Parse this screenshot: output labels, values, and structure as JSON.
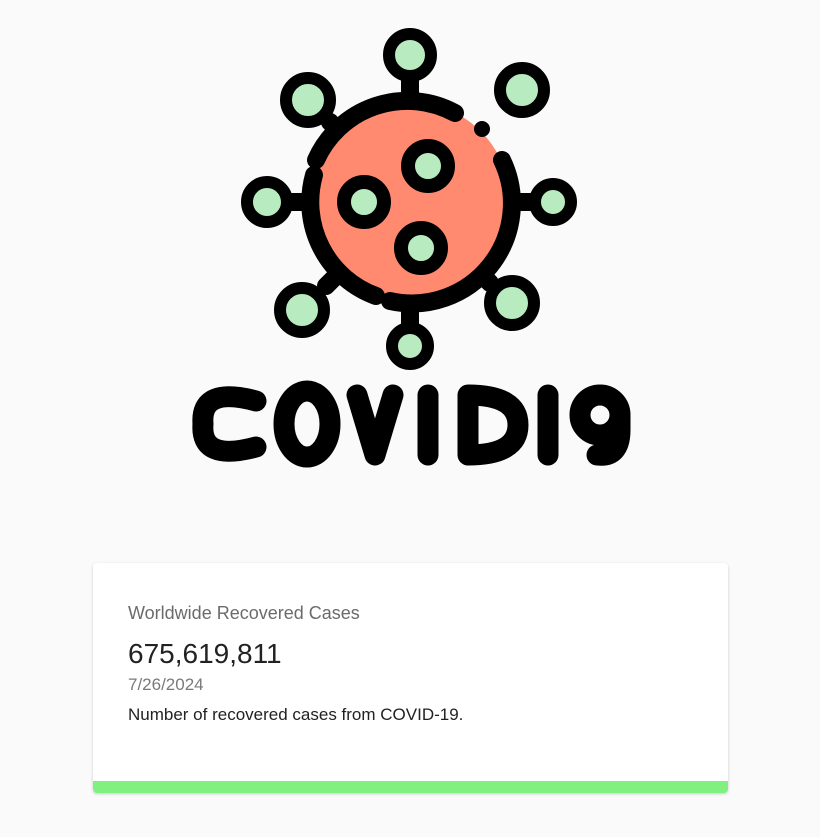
{
  "logo": {
    "wordmark": "COVID19",
    "virus_body_color": "#FF8A70",
    "spike_tip_color": "#B8ECC0",
    "outline_color": "#000000"
  },
  "card": {
    "title": "Worldwide Recovered Cases",
    "value": "675,619,811",
    "date": "7/26/2024",
    "description": "Number of recovered cases from COVID-19.",
    "bar_color": "#80F080"
  }
}
